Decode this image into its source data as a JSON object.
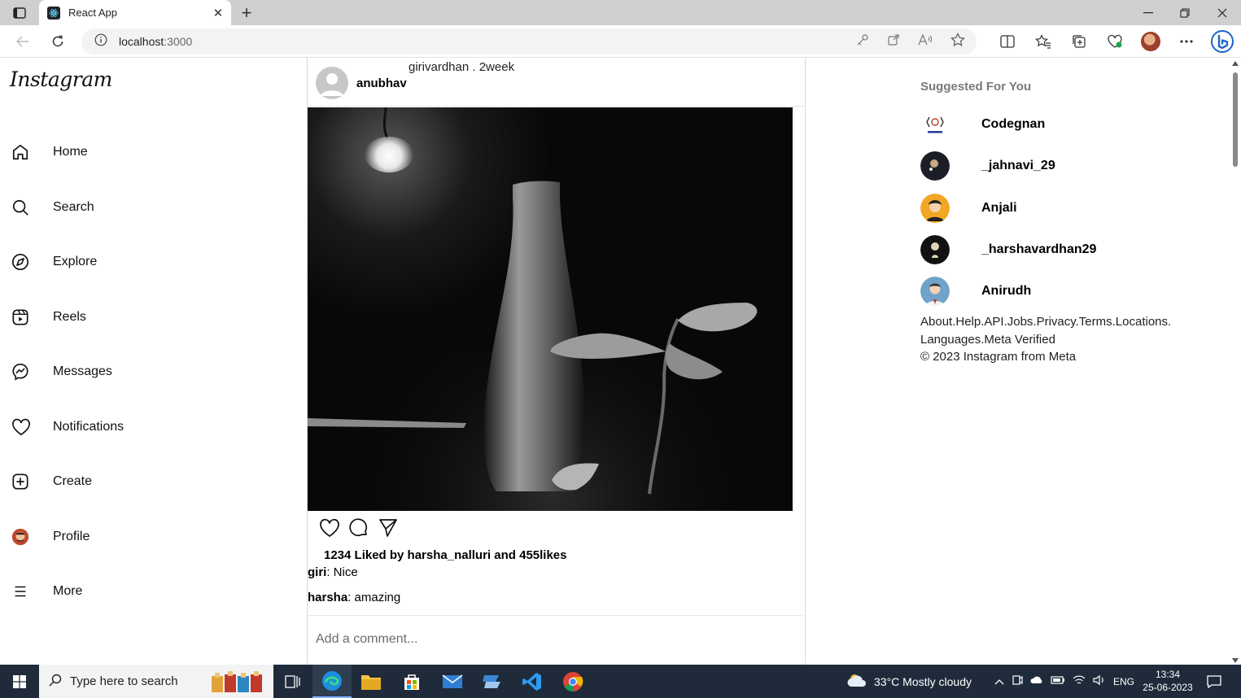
{
  "browser": {
    "tab_title": "React App",
    "url_host": "localhost",
    "url_port": ":3000"
  },
  "app": {
    "logo": "Instagram",
    "nav": [
      {
        "label": "Home",
        "icon": "home-icon"
      },
      {
        "label": "Search",
        "icon": "search-icon"
      },
      {
        "label": "Explore",
        "icon": "compass-icon"
      },
      {
        "label": "Reels",
        "icon": "reels-icon"
      },
      {
        "label": "Messages",
        "icon": "messenger-icon"
      },
      {
        "label": "Notifications",
        "icon": "heart-icon"
      },
      {
        "label": "Create",
        "icon": "plus-square-icon"
      },
      {
        "label": "Profile",
        "icon": "profile-avatar"
      },
      {
        "label": "More",
        "icon": "menu-icon"
      }
    ]
  },
  "post": {
    "subtitle": "girivardhan . 2week",
    "username": "anubhav",
    "likes_text": "1234 Liked by harsha_nalluri and 455likes",
    "comments": [
      {
        "user": "giri",
        "text": ": Nice"
      },
      {
        "user": "harsha",
        "text": ": amazing"
      }
    ],
    "comment_placeholder": "Add a comment..."
  },
  "suggestions": {
    "title": "Suggested For You",
    "users": [
      {
        "name": "Codegnan"
      },
      {
        "name": "_jahnavi_29"
      },
      {
        "name": "Anjali"
      },
      {
        "name": "_harshavardhan29"
      },
      {
        "name": "Anirudh"
      }
    ],
    "footer_line1": "About.Help.API.Jobs.Privacy.Terms.Locations.",
    "footer_line2": "Languages.Meta Verified",
    "footer_line3": "© 2023 Instagram from Meta"
  },
  "taskbar": {
    "search_placeholder": "Type here to search",
    "weather": "33°C  Mostly cloudy",
    "language": "ENG",
    "time": "13:34",
    "date": "25-06-2023"
  }
}
